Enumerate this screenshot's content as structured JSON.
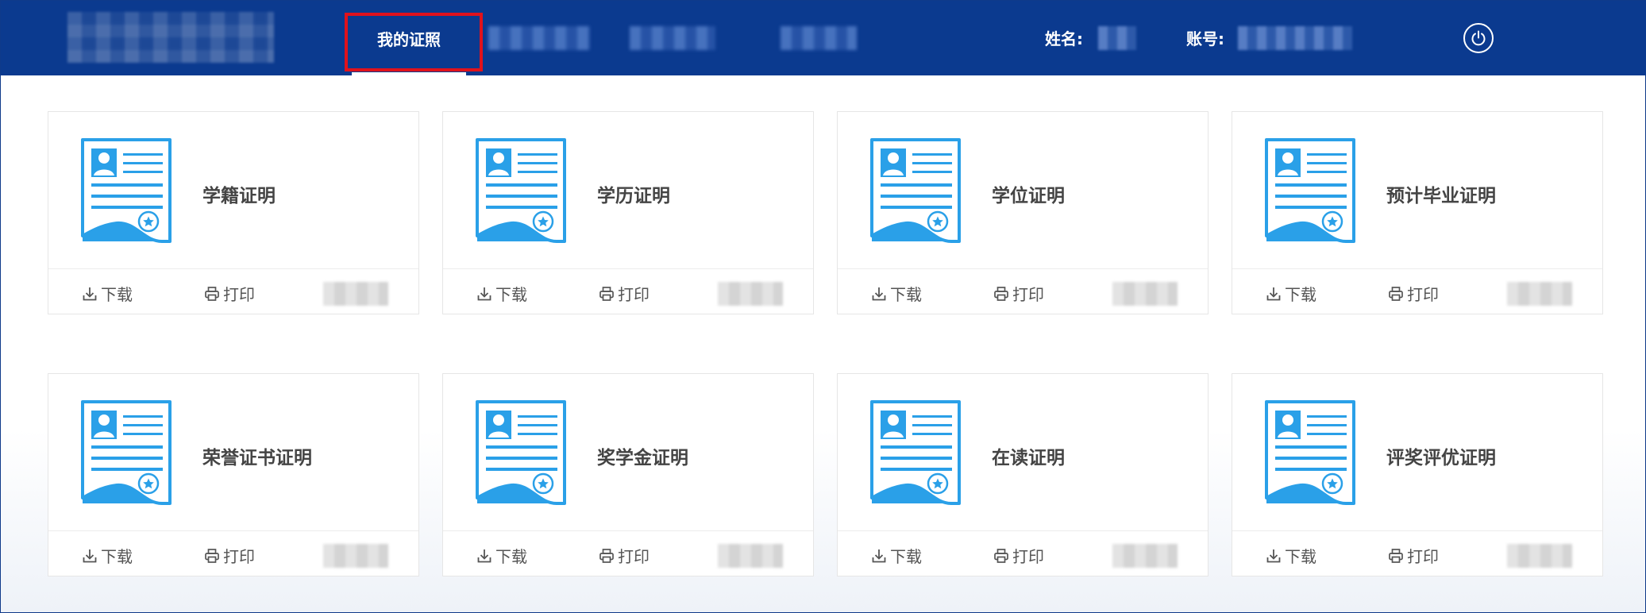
{
  "header": {
    "nav_active": "我的证照",
    "name_label": "姓名:",
    "account_label": "账号:"
  },
  "cards": [
    {
      "title": "学籍证明",
      "download": "下载",
      "print": "打印"
    },
    {
      "title": "学历证明",
      "download": "下载",
      "print": "打印"
    },
    {
      "title": "学位证明",
      "download": "下载",
      "print": "打印"
    },
    {
      "title": "预计毕业证明",
      "download": "下载",
      "print": "打印"
    },
    {
      "title": "荣誉证书证明",
      "download": "下载",
      "print": "打印"
    },
    {
      "title": "奖学金证明",
      "download": "下载",
      "print": "打印"
    },
    {
      "title": "在读证明",
      "download": "下载",
      "print": "打印"
    },
    {
      "title": "评奖评优证明",
      "download": "下载",
      "print": "打印"
    }
  ],
  "icons": {
    "certificate": "certificate-icon",
    "download": "download-icon",
    "print": "printer-icon",
    "power": "power-icon"
  },
  "colors": {
    "header_bg": "#0b3a8f",
    "icon_blue": "#2aa0e8",
    "highlight": "#e0121c"
  }
}
